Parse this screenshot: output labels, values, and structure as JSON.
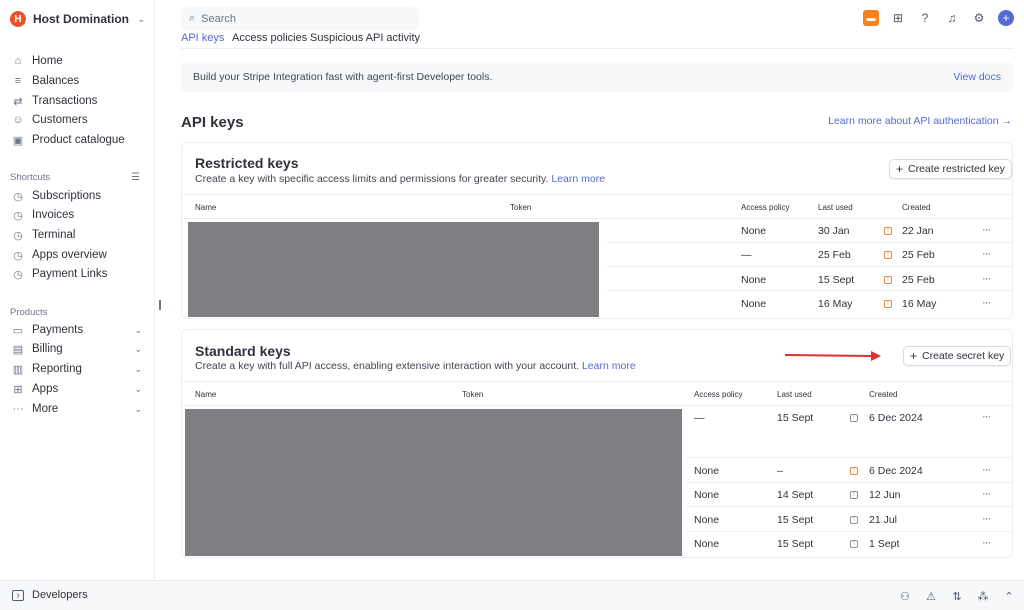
{
  "account": {
    "name": "Host Domination",
    "logo_letter": "H"
  },
  "sidebar": {
    "nav": [
      {
        "label": "Home",
        "icon": "home-icon",
        "glyph": "⌂"
      },
      {
        "label": "Balances",
        "icon": "balances-icon",
        "glyph": "≡"
      },
      {
        "label": "Transactions",
        "icon": "transactions-icon",
        "glyph": "⇄"
      },
      {
        "label": "Customers",
        "icon": "customers-icon",
        "glyph": "☺"
      },
      {
        "label": "Product catalogue",
        "icon": "box-icon",
        "glyph": "▣"
      }
    ],
    "shortcuts_label": "Shortcuts",
    "shortcuts": [
      {
        "label": "Subscriptions",
        "icon": "clock-icon",
        "glyph": "◷"
      },
      {
        "label": "Invoices",
        "icon": "clock-icon",
        "glyph": "◷"
      },
      {
        "label": "Terminal",
        "icon": "clock-icon",
        "glyph": "◷"
      },
      {
        "label": "Apps overview",
        "icon": "clock-icon",
        "glyph": "◷"
      },
      {
        "label": "Payment Links",
        "icon": "clock-icon",
        "glyph": "◷"
      }
    ],
    "products_label": "Products",
    "products": [
      {
        "label": "Payments",
        "icon": "payments-icon",
        "glyph": "▭"
      },
      {
        "label": "Billing",
        "icon": "billing-icon",
        "glyph": "▤"
      },
      {
        "label": "Reporting",
        "icon": "reporting-icon",
        "glyph": "▥"
      },
      {
        "label": "Apps",
        "icon": "apps-icon",
        "glyph": "⊞"
      },
      {
        "label": "More",
        "icon": "more-icon",
        "glyph": "···"
      }
    ]
  },
  "search": {
    "placeholder": "Search"
  },
  "tabs": [
    {
      "label": "API keys",
      "active": true
    },
    {
      "label": "Access policies",
      "active": false
    },
    {
      "label": "Suspicious API activity",
      "active": false
    }
  ],
  "banner": {
    "text": "Build your Stripe Integration fast with agent-first Developer tools.",
    "link": "View docs"
  },
  "page": {
    "title": "API keys",
    "auth_link": "Learn more about API authentication →"
  },
  "restricted": {
    "title": "Restricted keys",
    "description": "Create a key with specific access limits and permissions for greater security.",
    "learn_more": "Learn more",
    "create_button": "Create restricted key",
    "columns": {
      "name": "Name",
      "token": "Token",
      "policy": "Access policy",
      "last_used": "Last used",
      "created": "Created"
    },
    "rows": [
      {
        "policy": "None",
        "last_used": "30 Jan",
        "created": "22 Jan"
      },
      {
        "policy": "—",
        "last_used": "25 Feb",
        "created": "25 Feb"
      },
      {
        "policy": "None",
        "last_used": "15 Sept",
        "created": "25 Feb"
      },
      {
        "policy": "None",
        "last_used": "16 May",
        "created": "16 May"
      }
    ]
  },
  "standard": {
    "title": "Standard keys",
    "description": "Create a key with full API access, enabling extensive interaction with your account.",
    "learn_more": "Learn more",
    "create_button": "Create secret key",
    "columns": {
      "name": "Name",
      "token": "Token",
      "policy": "Access policy",
      "last_used": "Last used",
      "created": "Created"
    },
    "rows": [
      {
        "policy": "—",
        "last_used": "15 Sept",
        "created": "6 Dec 2024"
      },
      {
        "policy": "None",
        "last_used": "–",
        "created": "6 Dec 2024"
      },
      {
        "policy": "None",
        "last_used": "14 Sept",
        "created": "12 Jun"
      },
      {
        "policy": "None",
        "last_used": "15 Sept",
        "created": "21 Jul"
      },
      {
        "policy": "None",
        "last_used": "15 Sept",
        "created": "1 Sept"
      }
    ]
  },
  "bottom": {
    "developers_label": "Developers"
  },
  "colors": {
    "accent": "#5469d4",
    "warning": "#e6883d",
    "arrow": "#e03030",
    "redaction": "#7e7f82"
  }
}
